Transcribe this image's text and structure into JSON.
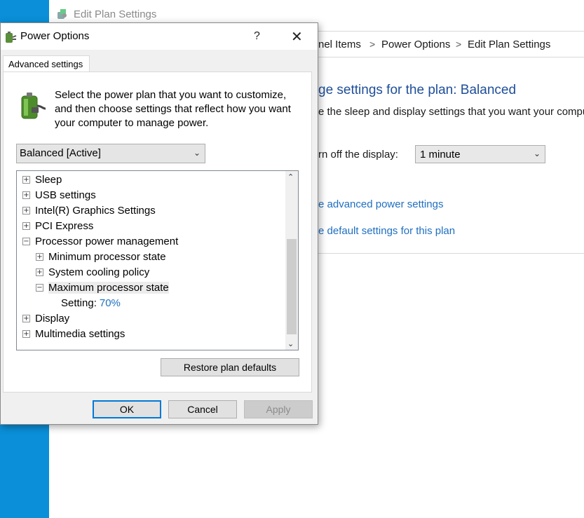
{
  "background_window": {
    "title": "Edit Plan Settings",
    "breadcrumb": [
      "nel Items",
      "Power Options",
      "Edit Plan Settings"
    ],
    "breadcrumb_sep": ">",
    "heading": "ge settings for the plan: Balanced",
    "subtext": "e the sleep and display settings that you want your compu",
    "display_label": "rn off the display:",
    "display_value": "1 minute",
    "link_advanced": "e advanced power settings",
    "link_restore": "e default settings for this plan"
  },
  "dialog": {
    "title": "Power Options",
    "help_glyph": "?",
    "close_glyph": "✕",
    "tab_label": "Advanced settings",
    "intro": "Select the power plan that you want to customize, and then choose settings that reflect how you want your computer to manage power.",
    "plan_value": "Balanced [Active]",
    "tree": {
      "sleep": "Sleep",
      "usb": "USB settings",
      "intel": "Intel(R) Graphics Settings",
      "pci": "PCI Express",
      "ppm": "Processor power management",
      "min_state": "Minimum processor state",
      "cooling": "System cooling policy",
      "max_state": "Maximum processor state",
      "setting_label": "Setting:",
      "setting_value": "70%",
      "display": "Display",
      "multimedia": "Multimedia settings"
    },
    "buttons": {
      "restore": "Restore plan defaults",
      "ok": "OK",
      "cancel": "Cancel",
      "apply": "Apply"
    }
  },
  "icons": {
    "power_options_icon": "battery-plug-icon",
    "control_panel_icon": "control-panel-icon"
  },
  "colors": {
    "link": "#1f6fc0",
    "heading": "#1e4e9a",
    "desktop": "#0a8fd8",
    "primary_border": "#0078d7"
  }
}
